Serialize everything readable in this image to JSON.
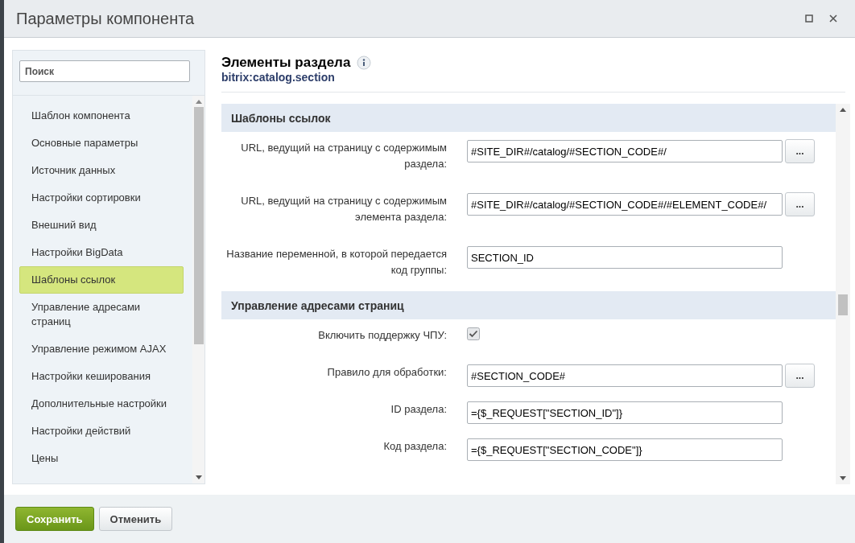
{
  "window": {
    "title": "Параметры компонента"
  },
  "search": {
    "placeholder": "Поиск"
  },
  "sidebar": {
    "items": [
      {
        "label": "Шаблон компонента",
        "selected": false
      },
      {
        "label": "Основные параметры",
        "selected": false
      },
      {
        "label": "Источник данных",
        "selected": false
      },
      {
        "label": "Настройки сортировки",
        "selected": false
      },
      {
        "label": "Внешний вид",
        "selected": false
      },
      {
        "label": "Настройки BigData",
        "selected": false
      },
      {
        "label": "Шаблоны ссылок",
        "selected": true
      },
      {
        "label": "Управление адресами страниц",
        "selected": false
      },
      {
        "label": "Управление режимом AJAX",
        "selected": false
      },
      {
        "label": "Настройки кеширования",
        "selected": false
      },
      {
        "label": "Дополнительные настройки",
        "selected": false
      },
      {
        "label": "Настройки действий",
        "selected": false
      },
      {
        "label": "Цены",
        "selected": false
      }
    ]
  },
  "component": {
    "title": "Элементы раздела",
    "code": "bitrix:catalog.section"
  },
  "sections": [
    {
      "title": "Шаблоны ссылок",
      "rows": [
        {
          "kind": "text",
          "label": "URL, ведущий на страницу с содержимым раздела:",
          "value": "#SITE_DIR#/catalog/#SECTION_CODE#/",
          "button": "..."
        },
        {
          "kind": "text",
          "label": "URL, ведущий на страницу с содержимым элемента раздела:",
          "value": "#SITE_DIR#/catalog/#SECTION_CODE#/#ELEMENT_CODE#/",
          "button": "..."
        },
        {
          "kind": "text",
          "label": "Название переменной, в которой передается код группы:",
          "value": "SECTION_ID"
        }
      ]
    },
    {
      "title": "Управление адресами страниц",
      "rows": [
        {
          "kind": "checkbox",
          "label": "Включить поддержку ЧПУ:",
          "checked": true
        },
        {
          "kind": "text",
          "label": "Правило для обработки:",
          "value": "#SECTION_CODE#",
          "button": "..."
        },
        {
          "kind": "text",
          "label": "ID раздела:",
          "value": "={$_REQUEST[\"SECTION_ID\"]}"
        },
        {
          "kind": "text",
          "label": "Код раздела:",
          "value": "={$_REQUEST[\"SECTION_CODE\"]}"
        }
      ]
    }
  ],
  "buttons": [
    {
      "label": "Сохранить",
      "kind": "primary"
    },
    {
      "label": "Отменить",
      "kind": "secondary"
    }
  ]
}
